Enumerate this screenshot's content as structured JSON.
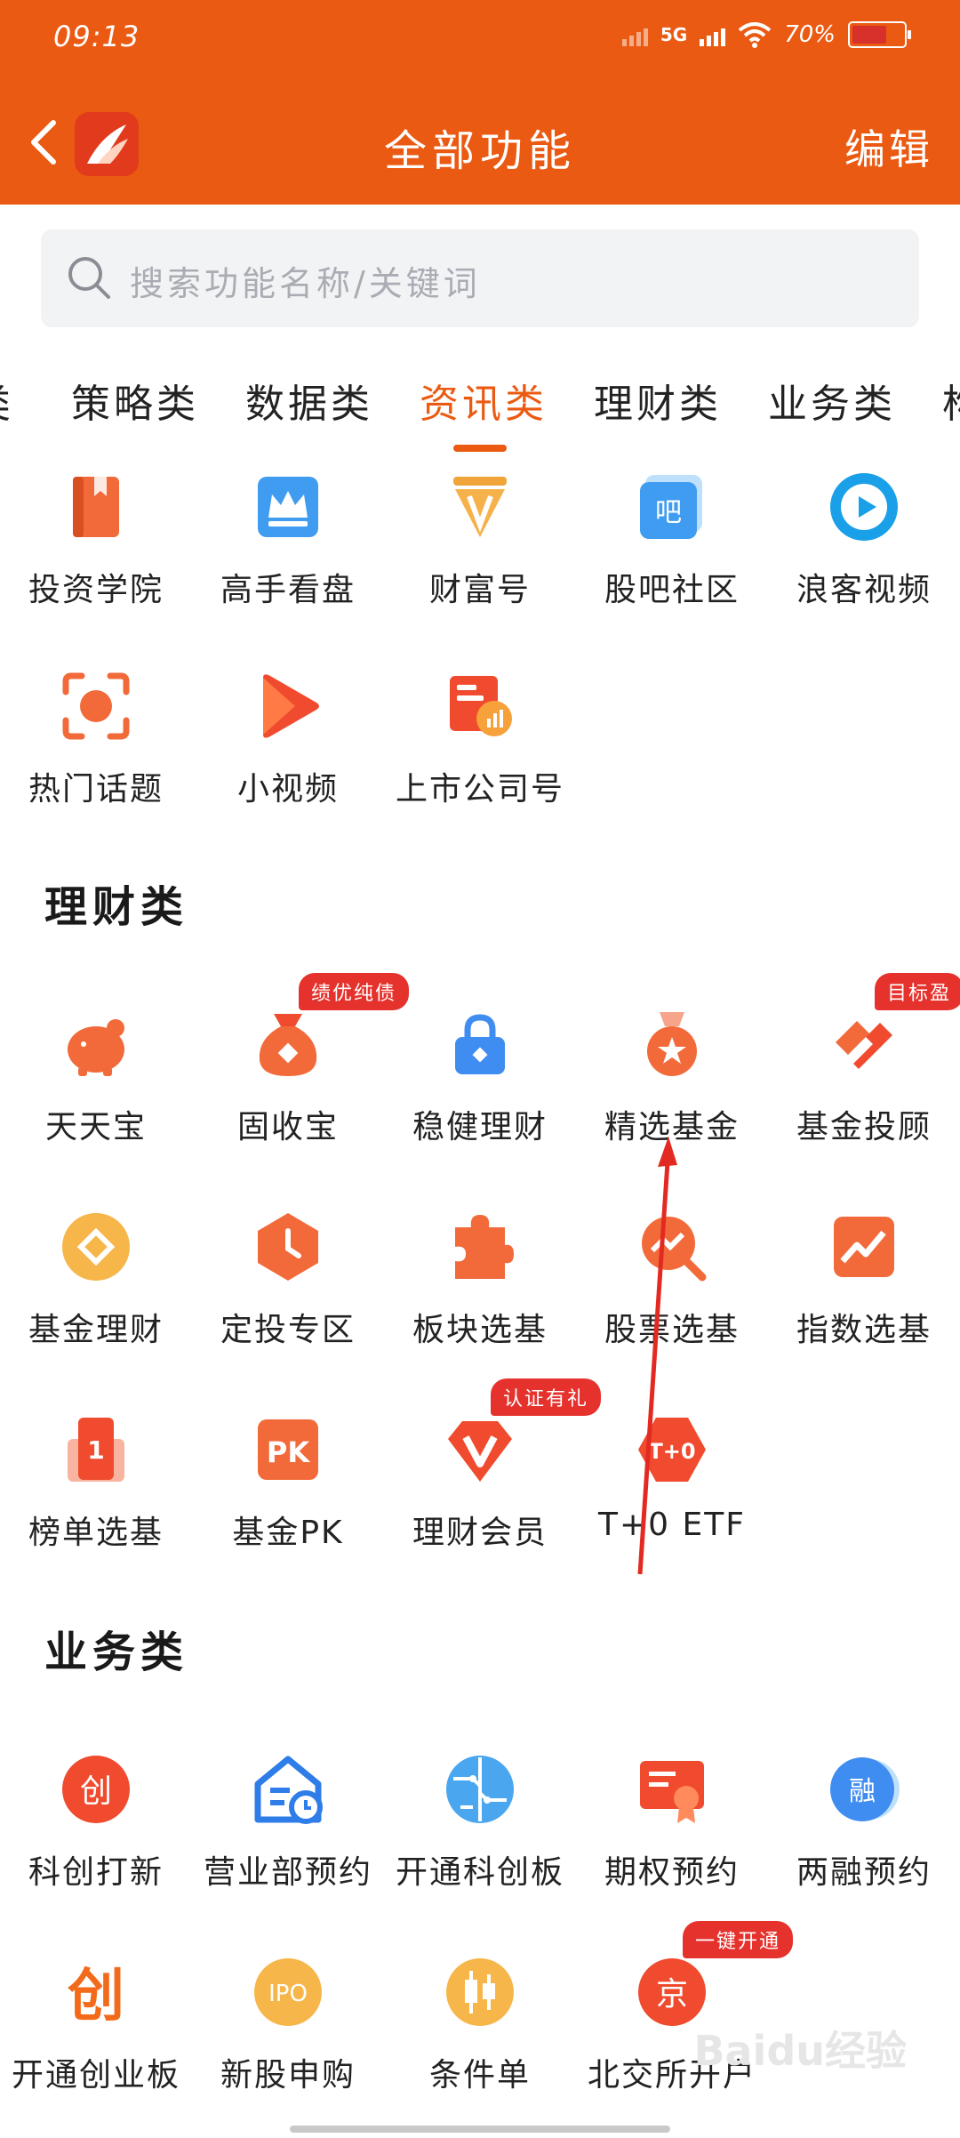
{
  "status": {
    "time": "09:13",
    "network": "5G",
    "battery": "70%"
  },
  "header": {
    "title": "全部功能",
    "edit_label": "编辑"
  },
  "search": {
    "placeholder": "搜索功能名称/关键词"
  },
  "category_tabs": [
    {
      "label": "类"
    },
    {
      "label": "策略类"
    },
    {
      "label": "数据类"
    },
    {
      "label": "资讯类",
      "active": true
    },
    {
      "label": "理财类"
    },
    {
      "label": "业务类"
    },
    {
      "label": "构"
    }
  ],
  "news": {
    "items": [
      {
        "label": "投资学院",
        "icon": "book-icon"
      },
      {
        "label": "高手看盘",
        "icon": "crown-icon"
      },
      {
        "label": "财富号",
        "icon": "pen-nib-icon"
      },
      {
        "label": "股吧社区",
        "icon": "forum-icon"
      },
      {
        "label": "浪客视频",
        "icon": "video-play-icon"
      },
      {
        "label": "热门话题",
        "icon": "focus-icon"
      },
      {
        "label": "小视频",
        "icon": "short-video-icon"
      },
      {
        "label": "上市公司号",
        "icon": "company-icon"
      }
    ]
  },
  "wealth": {
    "title": "理财类",
    "items": [
      {
        "label": "天天宝",
        "icon": "piggy-bank-icon"
      },
      {
        "label": "固收宝",
        "icon": "money-bag-icon",
        "badge": "绩优纯债"
      },
      {
        "label": "稳健理财",
        "icon": "lock-icon"
      },
      {
        "label": "精选基金",
        "icon": "medal-icon"
      },
      {
        "label": "基金投顾",
        "icon": "advisor-icon",
        "badge": "目标盈"
      },
      {
        "label": "基金理财",
        "icon": "coin-icon"
      },
      {
        "label": "定投专区",
        "icon": "clock-icon"
      },
      {
        "label": "板块选基",
        "icon": "puzzle-icon"
      },
      {
        "label": "股票选基",
        "icon": "stock-search-icon"
      },
      {
        "label": "指数选基",
        "icon": "trend-chart-icon"
      },
      {
        "label": "榜单选基",
        "icon": "ranking-icon"
      },
      {
        "label": "基金PK",
        "icon": "pk-icon"
      },
      {
        "label": "理财会员",
        "icon": "vip-icon",
        "badge": "认证有礼"
      },
      {
        "label": "T+0 ETF",
        "icon": "t0-icon"
      }
    ]
  },
  "business": {
    "title": "业务类",
    "items": [
      {
        "label": "科创打新",
        "icon": "chuang-circle-icon"
      },
      {
        "label": "营业部预约",
        "icon": "office-clock-icon"
      },
      {
        "label": "开通科创板",
        "icon": "circuit-icon"
      },
      {
        "label": "期权预约",
        "icon": "certificate-icon"
      },
      {
        "label": "两融预约",
        "icon": "rong-icon"
      },
      {
        "label": "开通创业板",
        "icon": "chuang-text-icon"
      },
      {
        "label": "新股申购",
        "icon": "ipo-icon"
      },
      {
        "label": "条件单",
        "icon": "candlestick-icon"
      },
      {
        "label": "北交所开户",
        "icon": "jing-icon",
        "badge": "一键开通"
      }
    ]
  },
  "watermark": "Baidu经验",
  "colors": {
    "brand": "#ea5a12",
    "badge": "#e5322d",
    "icon_orange": "#f26a3a"
  }
}
